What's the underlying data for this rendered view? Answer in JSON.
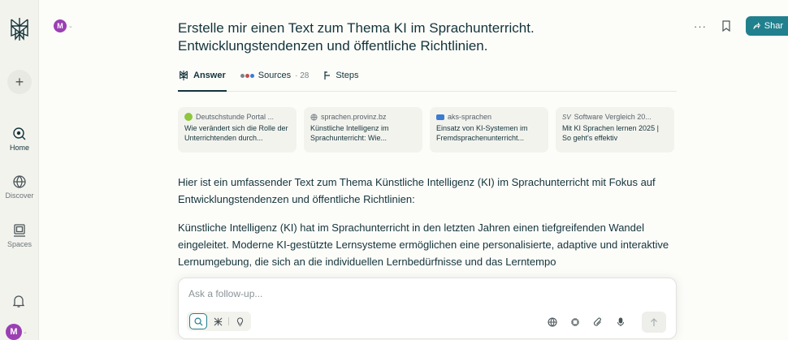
{
  "sidebar": {
    "new_label": "+",
    "items": [
      {
        "label": "Home",
        "icon": "home-icon"
      },
      {
        "label": "Discover",
        "icon": "discover-icon"
      },
      {
        "label": "Spaces",
        "icon": "spaces-icon"
      }
    ],
    "avatar_initial": "M"
  },
  "header": {
    "avatar_initial": "M",
    "more_label": "···",
    "share_label": "Shar"
  },
  "thread": {
    "title": "Erstelle mir einen Text zum Thema KI im Sprachunterricht. Entwicklungstendenzen und öffentliche Richtlinien.",
    "tabs": [
      {
        "label": "Answer"
      },
      {
        "label": "Sources",
        "count": "· 28"
      },
      {
        "label": "Steps"
      }
    ],
    "sources": [
      {
        "site": "Deutschstunde Portal ...",
        "title": "Wie verändert sich die Rolle der Unterrichtenden durch..."
      },
      {
        "site": "sprachen.provinz.bz",
        "title": "Künstliche Intelligenz im Sprachunterricht: Wie..."
      },
      {
        "site": "aks-sprachen",
        "title": "Einsatz von KI-Systemen im Fremdsprachenunterricht..."
      },
      {
        "site": "Software Vergleich 20...",
        "title": "Mit KI Sprachen lernen 2025 | So geht's effektiv"
      }
    ],
    "paragraphs": [
      "Hier ist ein umfassender Text zum Thema Künstliche Intelligenz (KI) im Sprachunterricht mit Fokus auf Entwicklungstendenzen und öffentliche Richtlinien:",
      "Künstliche Intelligenz (KI) hat im Sprachunterricht in den letzten Jahren einen tiefgreifenden Wandel eingeleitet. Moderne KI-gestützte Lernsysteme ermöglichen eine personalisierte, adaptive und interaktive Lernumgebung, die sich an die individuellen Lernbedürfnisse und das Lerntempo"
    ]
  },
  "composer": {
    "placeholder": "Ask a follow-up..."
  },
  "colors": {
    "accent": "#21808d",
    "text": "#13343b",
    "sidebar_bg": "#f3f3ee",
    "avatar": "#9b3fb4"
  }
}
